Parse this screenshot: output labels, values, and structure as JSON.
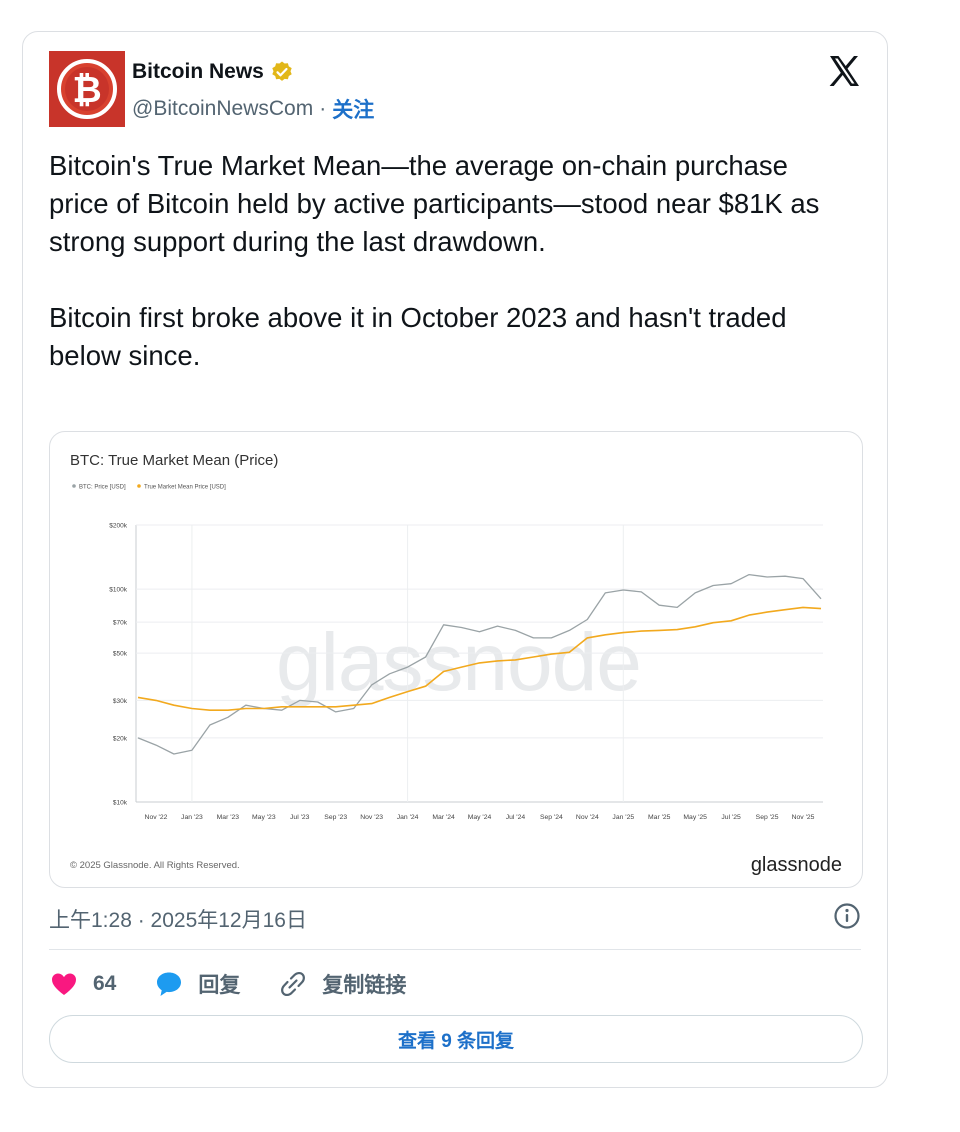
{
  "tweet": {
    "author_name": "Bitcoin News",
    "handle": "@BitcoinNewsCom",
    "separator": "·",
    "follow_label": "关注",
    "paragraphs": [
      "Bitcoin's True Market Mean—the average on-chain purchase price of Bitcoin held by active participants—stood near $81K as strong support during the last drawdown.",
      "Bitcoin first broke above it in October 2023 and hasn't traded below since."
    ],
    "timestamp": "上午1:28 · 2025年12月16日"
  },
  "actions": {
    "like_count": "64",
    "reply_label": "回复",
    "copy_link_label": "复制链接",
    "view_replies_label": "查看 9 条回复"
  },
  "colors": {
    "like": "#f91880",
    "reply": "#1d9bf0",
    "link": "#1d70c9",
    "btc_series": "#9aa3a6",
    "tmm_series": "#f2a91e"
  },
  "chart_data": {
    "type": "line",
    "title": "BTC: True Market Mean (Price)",
    "legend": [
      "BTC: Price [USD]",
      "True Market Mean Price [USD]"
    ],
    "yscale": "log",
    "yticks": [
      "$200k",
      "$100k",
      "$70k",
      "$50k",
      "$30k",
      "$20k",
      "$10k"
    ],
    "ytick_values": [
      200000,
      100000,
      70000,
      50000,
      30000,
      20000,
      10000
    ],
    "ylim": [
      10000,
      200000
    ],
    "xticks": [
      "Nov '22",
      "Jan '23",
      "Mar '23",
      "May '23",
      "Jul '23",
      "Sep '23",
      "Nov '23",
      "Jan '24",
      "Mar '24",
      "May '24",
      "Jul '24",
      "Sep '24",
      "Nov '24",
      "Jan '25",
      "Mar '25",
      "May '25",
      "Jul '25",
      "Sep '25",
      "Nov '25"
    ],
    "x_dates": [
      "2022-10",
      "2022-11",
      "2022-12",
      "2023-01",
      "2023-02",
      "2023-03",
      "2023-04",
      "2023-05",
      "2023-06",
      "2023-07",
      "2023-08",
      "2023-09",
      "2023-10",
      "2023-11",
      "2023-12",
      "2024-01",
      "2024-02",
      "2024-03",
      "2024-04",
      "2024-05",
      "2024-06",
      "2024-07",
      "2024-08",
      "2024-09",
      "2024-10",
      "2024-11",
      "2024-12",
      "2025-01",
      "2025-02",
      "2025-03",
      "2025-04",
      "2025-05",
      "2025-06",
      "2025-07",
      "2025-08",
      "2025-09",
      "2025-10",
      "2025-11",
      "2025-12"
    ],
    "series": [
      {
        "name": "BTC: Price [USD]",
        "values": [
          20000,
          18500,
          16800,
          17500,
          23000,
          25000,
          28500,
          27500,
          27000,
          30000,
          29500,
          26500,
          27500,
          35500,
          40000,
          43000,
          48000,
          68000,
          66000,
          63000,
          67000,
          64000,
          59000,
          59000,
          64000,
          72000,
          96000,
          99000,
          97000,
          84000,
          82000,
          96000,
          104000,
          106000,
          117000,
          114000,
          115000,
          112000,
          90000
        ]
      },
      {
        "name": "True Market Mean Price [USD]",
        "values": [
          31000,
          30000,
          28500,
          27500,
          27000,
          27000,
          27500,
          27500,
          28000,
          28000,
          28000,
          28000,
          28500,
          29000,
          31000,
          33000,
          35000,
          41000,
          43000,
          45000,
          46000,
          46500,
          48000,
          49500,
          50500,
          59000,
          61000,
          62500,
          63500,
          64000,
          64500,
          66500,
          69500,
          71000,
          75500,
          78000,
          80000,
          82000,
          81000
        ]
      }
    ],
    "watermark": "glassnode",
    "copyright": "© 2025 Glassnode. All Rights Reserved.",
    "brand": "glassnode"
  }
}
